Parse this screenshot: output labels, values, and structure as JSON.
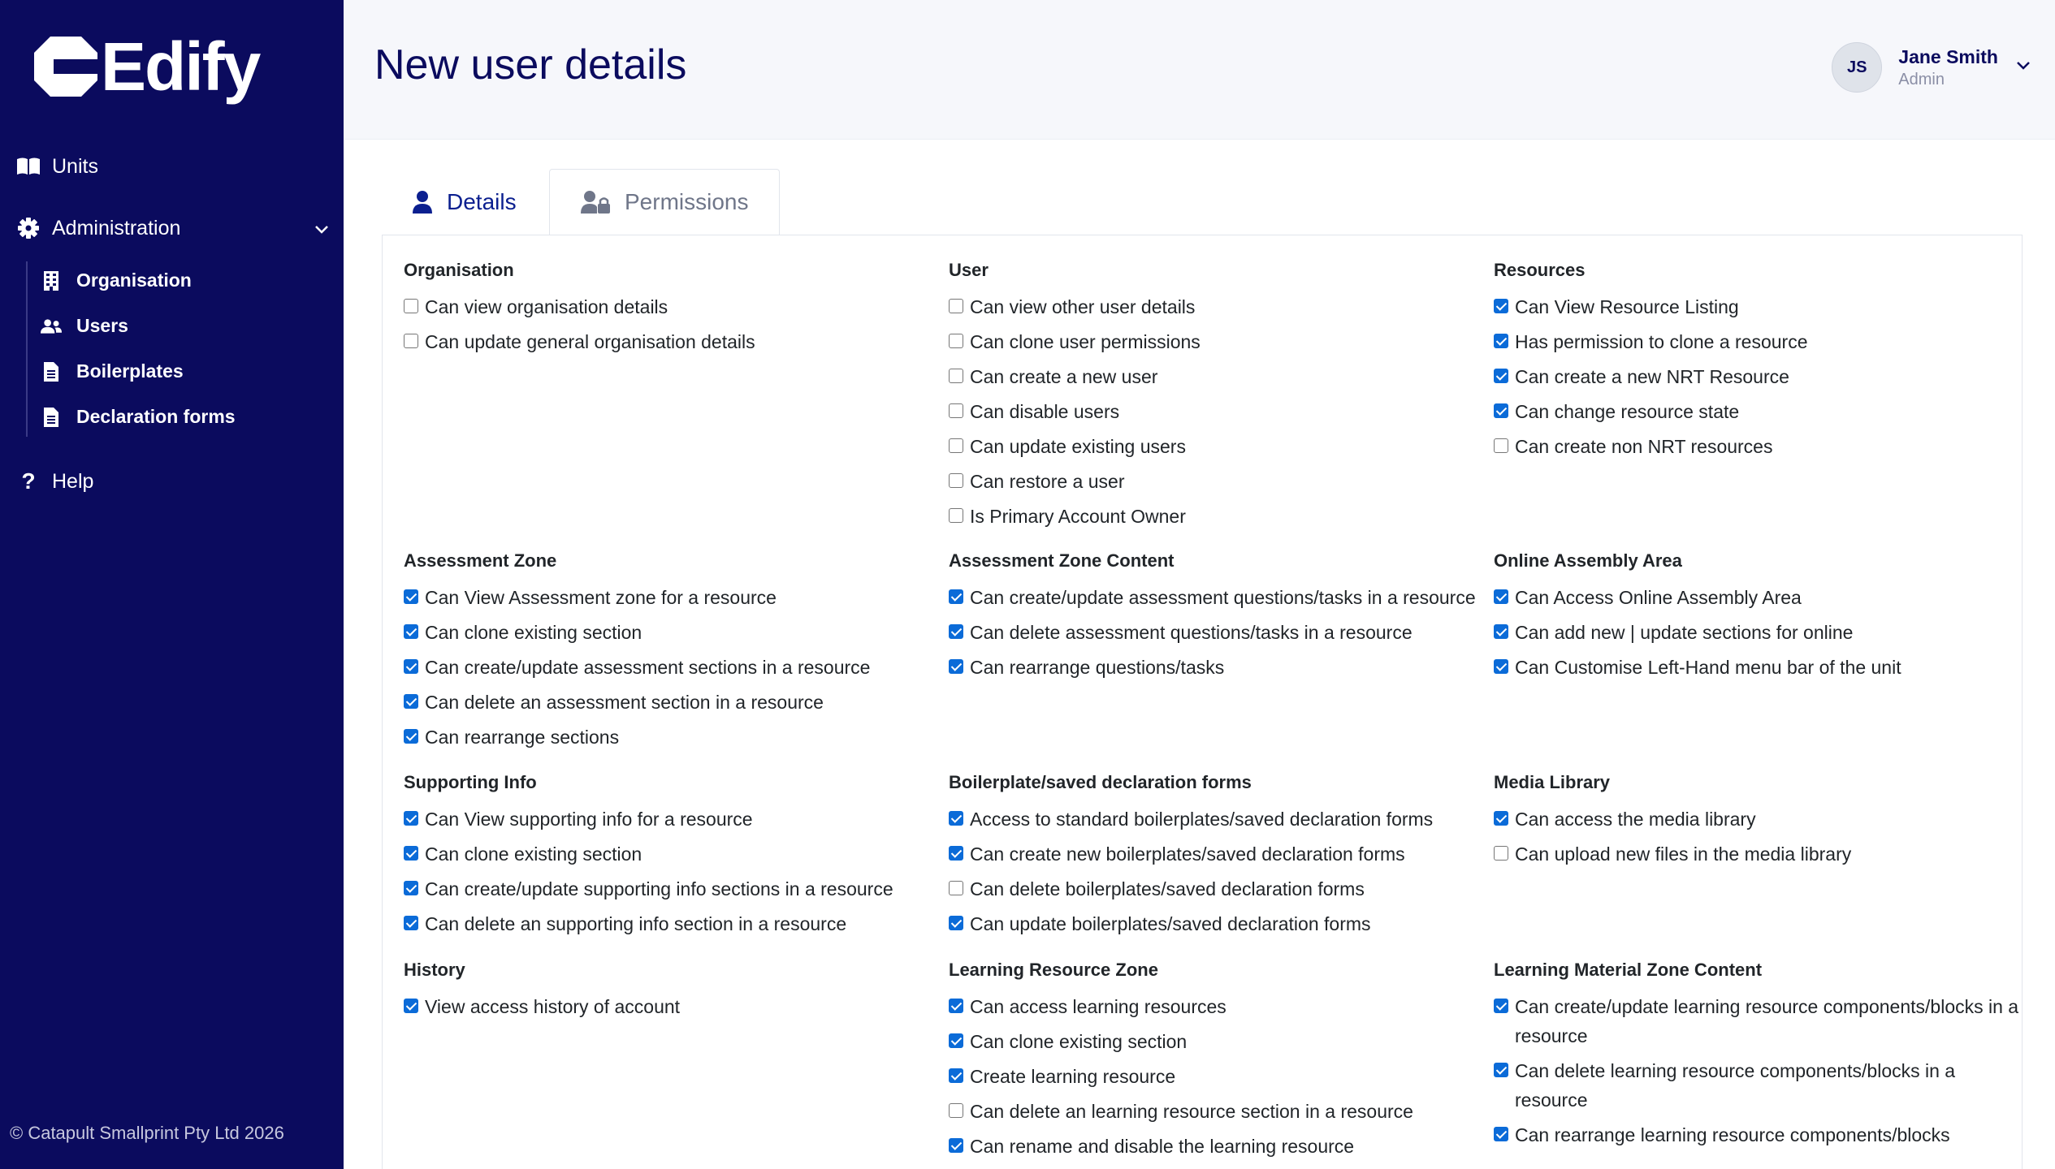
{
  "sidebar": {
    "logo_text": "Edify",
    "nav": {
      "units": "Units",
      "administration": "Administration",
      "help": "Help"
    },
    "admin_items": [
      "Organisation",
      "Users",
      "Boilerplates",
      "Declaration forms"
    ],
    "copyright": "© Catapult Smallprint Pty Ltd 2026",
    "colors": {
      "background": "#0b0b5e",
      "text": "#ffffff"
    }
  },
  "header": {
    "title": "New user details",
    "user": {
      "initials": "JS",
      "name": "Jane Smith",
      "role": "Admin"
    }
  },
  "tabs": {
    "details": "Details",
    "permissions": "Permissions",
    "active": "Details"
  },
  "sections": [
    {
      "title": "Organisation",
      "items": [
        {
          "label": "Can view organisation details",
          "checked": false
        },
        {
          "label": "Can update general organisation details",
          "checked": false
        }
      ]
    },
    {
      "title": "User",
      "items": [
        {
          "label": "Can view other user details",
          "checked": false
        },
        {
          "label": "Can clone user permissions",
          "checked": false
        },
        {
          "label": "Can create a new user",
          "checked": false
        },
        {
          "label": "Can disable users",
          "checked": false
        },
        {
          "label": "Can update existing users",
          "checked": false
        },
        {
          "label": "Can restore a user",
          "checked": false
        },
        {
          "label": "Is Primary Account Owner",
          "checked": false
        }
      ]
    },
    {
      "title": "Resources",
      "items": [
        {
          "label": "Can View Resource Listing",
          "checked": true
        },
        {
          "label": "Has permission to clone a resource",
          "checked": true
        },
        {
          "label": "Can create a new NRT Resource",
          "checked": true
        },
        {
          "label": "Can change resource state",
          "checked": true
        },
        {
          "label": "Can create non NRT resources",
          "checked": false
        }
      ]
    },
    {
      "title": "Assessment Zone",
      "items": [
        {
          "label": "Can View Assessment zone for a resource",
          "checked": true
        },
        {
          "label": "Can clone existing section",
          "checked": true
        },
        {
          "label": "Can create/update assessment sections in a resource",
          "checked": true
        },
        {
          "label": "Can delete an assessment section in a resource",
          "checked": true
        },
        {
          "label": "Can rearrange sections",
          "checked": true
        }
      ]
    },
    {
      "title": "Assessment Zone Content",
      "items": [
        {
          "label": "Can create/update assessment questions/tasks in a resource",
          "checked": true
        },
        {
          "label": "Can delete assessment questions/tasks in a resource",
          "checked": true
        },
        {
          "label": "Can rearrange questions/tasks",
          "checked": true
        }
      ]
    },
    {
      "title": "Online Assembly Area",
      "items": [
        {
          "label": "Can Access Online Assembly Area",
          "checked": true
        },
        {
          "label": "Can add new | update sections for online",
          "checked": true
        },
        {
          "label": "Can Customise Left-Hand menu bar of the unit",
          "checked": true
        }
      ]
    },
    {
      "title": "Supporting Info",
      "items": [
        {
          "label": "Can View supporting info for a resource",
          "checked": true
        },
        {
          "label": "Can clone existing section",
          "checked": true
        },
        {
          "label": "Can create/update supporting info sections in a resource",
          "checked": true
        },
        {
          "label": "Can delete an supporting info section in a resource",
          "checked": true
        }
      ]
    },
    {
      "title": "Boilerplate/saved declaration forms",
      "items": [
        {
          "label": "Access to standard boilerplates/saved declaration forms",
          "checked": true
        },
        {
          "label": "Can create new boilerplates/saved declaration forms",
          "checked": true
        },
        {
          "label": "Can delete boilerplates/saved declaration forms",
          "checked": false
        },
        {
          "label": "Can update boilerplates/saved declaration forms",
          "checked": true
        }
      ]
    },
    {
      "title": "Media Library",
      "items": [
        {
          "label": "Can access the media library",
          "checked": true
        },
        {
          "label": "Can upload new files in the media library",
          "checked": false
        }
      ]
    },
    {
      "title": "History",
      "items": [
        {
          "label": "View access history of account",
          "checked": true
        }
      ]
    },
    {
      "title": "Learning Resource Zone",
      "items": [
        {
          "label": "Can access learning resources",
          "checked": true
        },
        {
          "label": "Can clone existing section",
          "checked": true
        },
        {
          "label": "Create learning resource",
          "checked": true
        },
        {
          "label": "Can delete an learning resource section in a resource",
          "checked": false
        },
        {
          "label": "Can rename and disable the learning resource",
          "checked": true
        }
      ]
    },
    {
      "title": "Learning Material Zone Content",
      "items": [
        {
          "label": "Can create/update learning resource components/blocks in a resource",
          "checked": true
        },
        {
          "label": "Can delete learning resource components/blocks in a resource",
          "checked": true
        },
        {
          "label": "Can rearrange learning resource components/blocks",
          "checked": true
        }
      ]
    }
  ],
  "colors": {
    "brand_navy": "#0b0b5e",
    "checkbox_checked": "#0b6bd8",
    "header_bg": "#f6f7fb"
  }
}
